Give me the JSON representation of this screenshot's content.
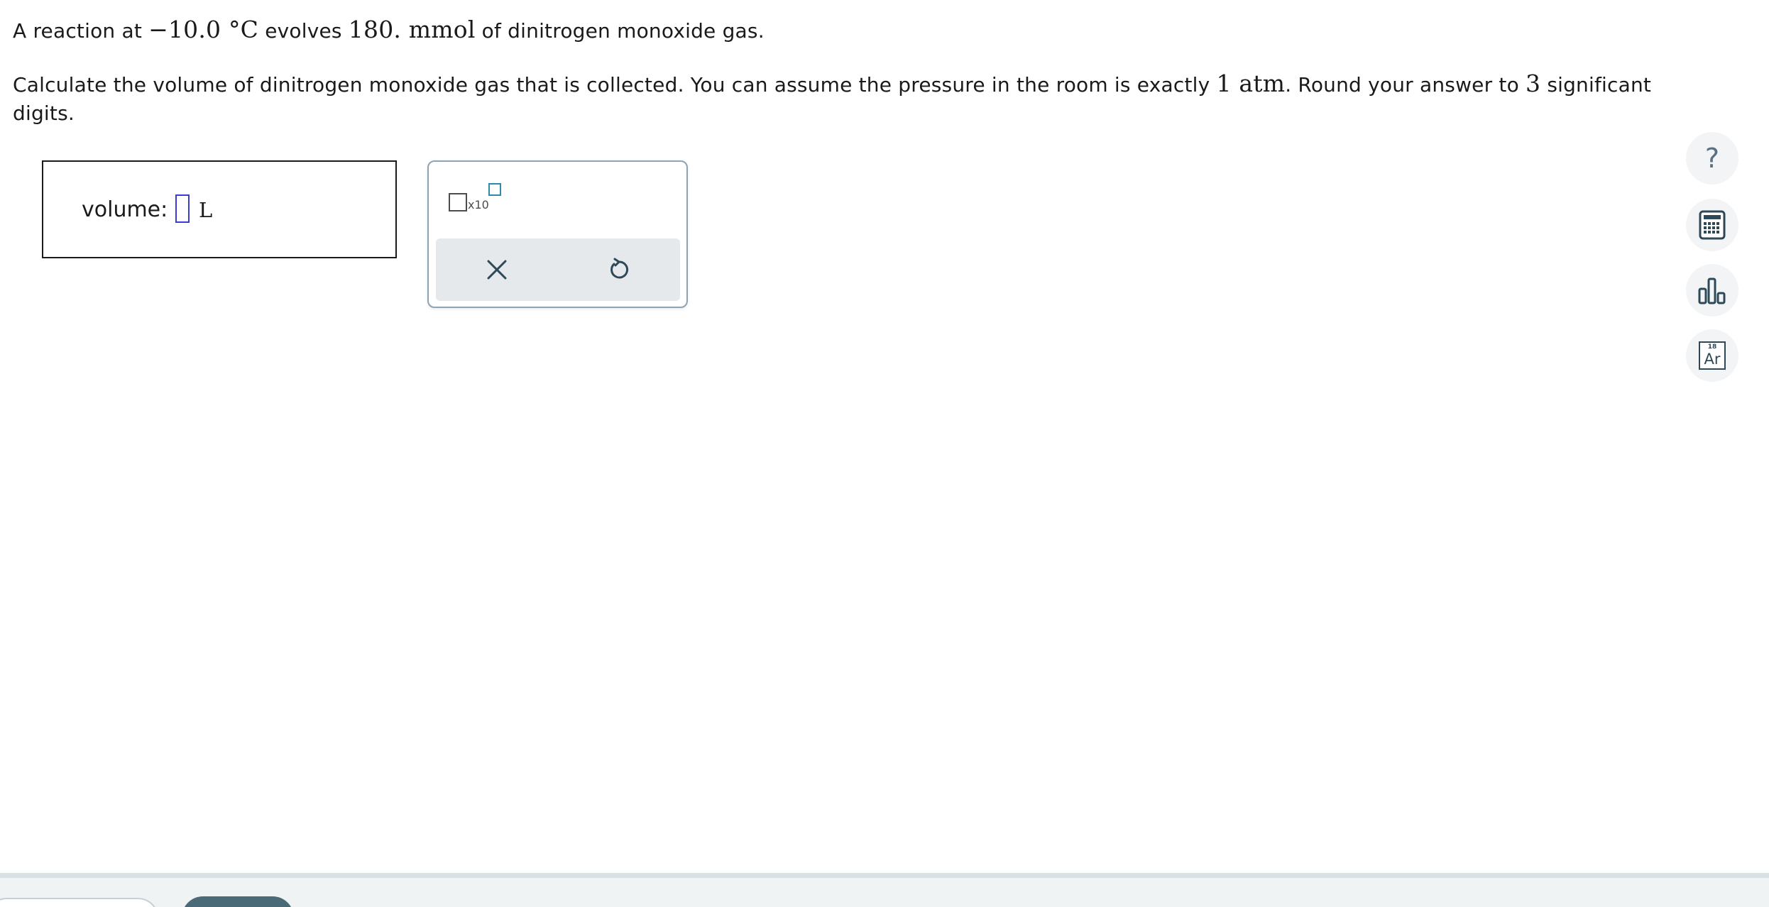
{
  "question": {
    "line1": {
      "t1": "A reaction at ",
      "temp_value": "−10.0",
      "temp_unit": " °C",
      "t2": " evolves ",
      "amount_value": "180.",
      "amount_unit": " mmol",
      "t3": " of dinitrogen monoxide gas."
    },
    "line2": {
      "t1": "Calculate the volume of dinitrogen monoxide gas that is collected. You can assume the pressure in the room is exactly ",
      "pressure_value": "1",
      "pressure_unit": " atm",
      "t2": ". Round your answer to ",
      "sig_figs": "3",
      "t3": " significant digits."
    }
  },
  "answer": {
    "label": "volume:",
    "value": "",
    "unit": "L"
  },
  "keypad": {
    "sci_notation_label": "x10",
    "clear_icon": "x-icon",
    "undo_icon": "undo-icon"
  },
  "sidebar": {
    "help_glyph": "?",
    "calculator_icon": "calculator-icon",
    "data_icon": "bar-chart-icon",
    "periodic_table": {
      "number": "18",
      "symbol": "Ar"
    }
  },
  "colors": {
    "input_border": "#3b3bd6",
    "icon": "#2f4858",
    "tool_bg": "#f2f4f5",
    "primary_button": "#4b6a78"
  }
}
